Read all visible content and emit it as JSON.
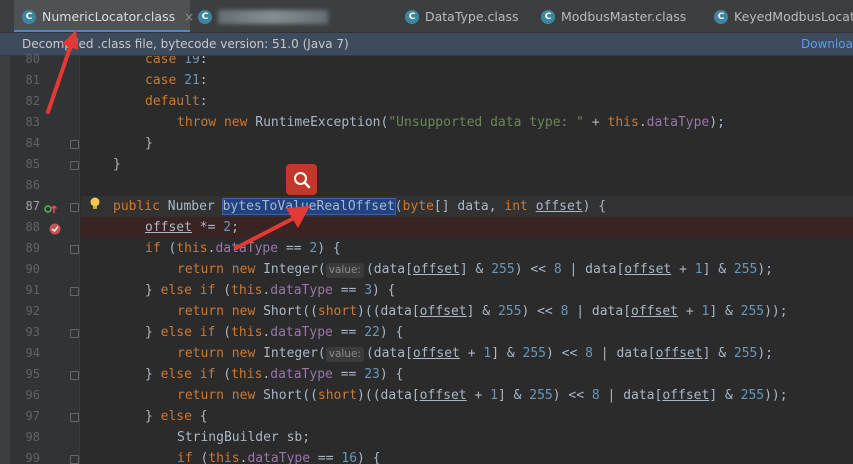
{
  "tabs": [
    {
      "label": "NumericLocator.class",
      "icon": "C"
    },
    {
      "label": "",
      "icon": "C"
    },
    {
      "label": "DataType.class",
      "icon": "C"
    },
    {
      "label": "ModbusMaster.class",
      "icon": "C"
    },
    {
      "label": "KeyedModbusLocato",
      "icon": "C"
    }
  ],
  "close_glyph": "×",
  "banner": {
    "text": "Decompiled .class file, bytecode version: 51.0 (Java 7)",
    "link": "Downloa"
  },
  "line_numbers": [
    "80",
    "81",
    "82",
    "83",
    "84",
    "85",
    "86",
    "87",
    "88",
    "89",
    "90",
    "91",
    "92",
    "93",
    "94",
    "95",
    "96",
    "97",
    "98",
    "99"
  ],
  "code": {
    "l80": {
      "kw": "case",
      "num": "19",
      "p": ":"
    },
    "l81": {
      "kw": "case",
      "num": "21",
      "p": ":"
    },
    "l82": {
      "kw": "default",
      "p": ":"
    },
    "l83": {
      "kw1": "throw",
      "kw2": "new",
      "t1": "RuntimeException(",
      "str": "\"Unsupported data type: \"",
      "t2": " + ",
      "kw3": "this",
      "t3": ".",
      "fld": "dataType",
      "t4": ");"
    },
    "l84": {
      "t": "}"
    },
    "l85": {
      "t": "}"
    },
    "l87": {
      "kw1": "public",
      "t1": "Number",
      "sel": "bytesToValueRealOffset",
      "t2": "(",
      "kw2": "byte",
      "t3": "[] data, ",
      "kw3": "int",
      "prm": "offset",
      "t4": ") {"
    },
    "l88": {
      "prm": "offset",
      "t1": " *= ",
      "num": "2",
      "t2": ";"
    },
    "l89": {
      "kw1": "if",
      "t1": " (",
      "kw2": "this",
      "t2": ".",
      "fld": "dataType",
      "t3": " == ",
      "num": "2",
      "t4": ") {"
    },
    "l90": {
      "kw1": "return",
      "kw2": "new",
      "t1": "Integer(",
      "hint": "value:",
      "t2": "(data[",
      "prm1": "offset",
      "t3": "] & ",
      "n1": "255",
      "t4": ") << ",
      "n2": "8",
      "t5": " | data[",
      "prm2": "offset",
      "t6": " + ",
      "n3": "1",
      "t7": "] & ",
      "n4": "255",
      "t8": ");"
    },
    "l91": {
      "t0": "} ",
      "kw1": "else",
      "kw2": "if",
      "t1": " (",
      "kw3": "this",
      "t2": ".",
      "fld": "dataType",
      "t3": " == ",
      "num": "3",
      "t4": ") {"
    },
    "l92": {
      "kw1": "return",
      "kw2": "new",
      "t1": "Short((",
      "kw3": "short",
      "t2": ")((data[",
      "prm1": "offset",
      "t3": "] & ",
      "n1": "255",
      "t4": ") << ",
      "n2": "8",
      "t5": " | data[",
      "prm2": "offset",
      "t6": " + ",
      "n3": "1",
      "t7": "] & ",
      "n4": "255",
      "t8": "));"
    },
    "l93": {
      "t0": "} ",
      "kw1": "else",
      "kw2": "if",
      "t1": " (",
      "kw3": "this",
      "t2": ".",
      "fld": "dataType",
      "t3": " == ",
      "num": "22",
      "t4": ") {"
    },
    "l94": {
      "kw1": "return",
      "kw2": "new",
      "t1": "Integer(",
      "hint": "value:",
      "t2": "(data[",
      "prm1": "offset",
      "t3": " + ",
      "n1": "1",
      "t4": "] & ",
      "n2": "255",
      "t5": ") << ",
      "n3": "8",
      "t6": " | data[",
      "prm2": "offset",
      "t7": "] & ",
      "n4": "255",
      "t8": ");"
    },
    "l95": {
      "t0": "} ",
      "kw1": "else",
      "kw2": "if",
      "t1": " (",
      "kw3": "this",
      "t2": ".",
      "fld": "dataType",
      "t3": " == ",
      "num": "23",
      "t4": ") {"
    },
    "l96": {
      "kw1": "return",
      "kw2": "new",
      "t1": "Short((",
      "kw3": "short",
      "t2": ")((data[",
      "prm1": "offset",
      "t3": " + ",
      "n1": "1",
      "t4": "] & ",
      "n2": "255",
      "t5": ") << ",
      "n3": "8",
      "t6": " | data[",
      "prm2": "offset",
      "t7": "] & ",
      "n4": "255",
      "t8": "));"
    },
    "l97": {
      "t0": "} ",
      "kw": "else",
      "t1": " {"
    },
    "l98": {
      "t": "StringBuilder sb;"
    },
    "l99": {
      "kw1": "if",
      "t1": " (",
      "kw2": "this",
      "t2": ".",
      "fld": "dataType",
      "t3": " == ",
      "num": "16",
      "t4": ") {"
    }
  },
  "colors": {
    "keyword": "#cc7832",
    "number": "#6897bb",
    "string": "#6a8759",
    "field": "#9876aa",
    "selection": "#214283",
    "annotation_arrow": "#e53935"
  },
  "icons": {
    "tab_file": "java-class-icon",
    "bulb": "intention-bulb-icon",
    "search": "search-icon",
    "override": "override-marker-icon",
    "breakpoint": "breakpoint-icon"
  }
}
